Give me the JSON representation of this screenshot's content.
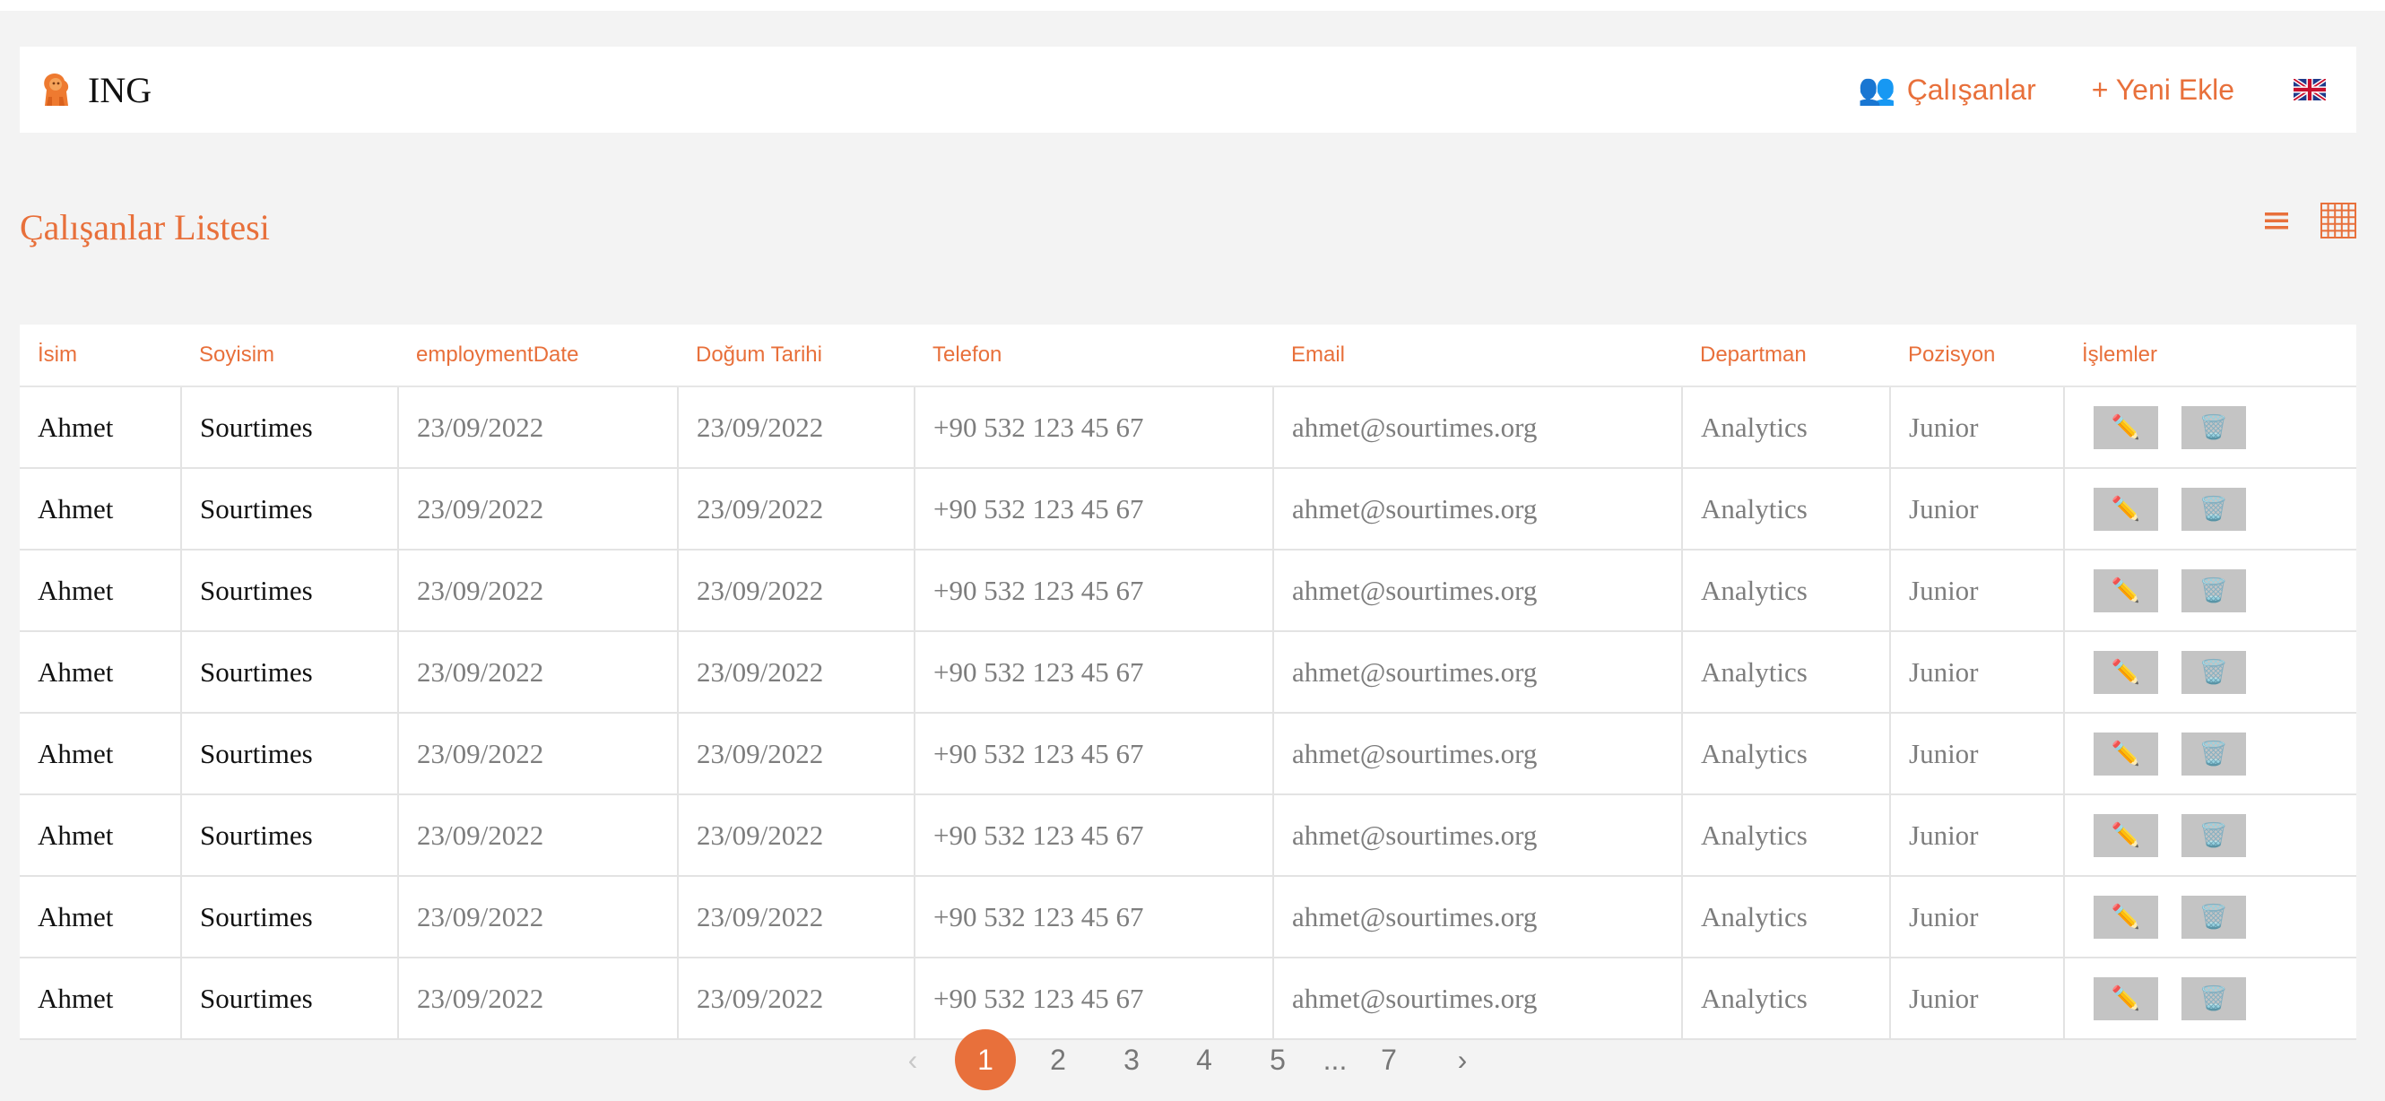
{
  "brand": {
    "name": "ING"
  },
  "nav": {
    "employees_label": "Çalışanlar",
    "add_new_label": "+ Yeni Ekle"
  },
  "page": {
    "title": "Çalışanlar Listesi"
  },
  "colors": {
    "accent": "#e8703b",
    "action_button": "#c4c4c4"
  },
  "table": {
    "headers": [
      "İsim",
      "Soyisim",
      "employmentDate",
      "Doğum Tarihi",
      "Telefon",
      "Email",
      "Departman",
      "Pozisyon",
      "İşlemler"
    ],
    "rows": [
      {
        "first": "Ahmet",
        "last": "Sourtimes",
        "employment": "23/09/2022",
        "birth": "23/09/2022",
        "phone": "+90 532 123 45 67",
        "email": "ahmet@sourtimes.org",
        "department": "Analytics",
        "position": "Junior"
      },
      {
        "first": "Ahmet",
        "last": "Sourtimes",
        "employment": "23/09/2022",
        "birth": "23/09/2022",
        "phone": "+90 532 123 45 67",
        "email": "ahmet@sourtimes.org",
        "department": "Analytics",
        "position": "Junior"
      },
      {
        "first": "Ahmet",
        "last": "Sourtimes",
        "employment": "23/09/2022",
        "birth": "23/09/2022",
        "phone": "+90 532 123 45 67",
        "email": "ahmet@sourtimes.org",
        "department": "Analytics",
        "position": "Junior"
      },
      {
        "first": "Ahmet",
        "last": "Sourtimes",
        "employment": "23/09/2022",
        "birth": "23/09/2022",
        "phone": "+90 532 123 45 67",
        "email": "ahmet@sourtimes.org",
        "department": "Analytics",
        "position": "Junior"
      },
      {
        "first": "Ahmet",
        "last": "Sourtimes",
        "employment": "23/09/2022",
        "birth": "23/09/2022",
        "phone": "+90 532 123 45 67",
        "email": "ahmet@sourtimes.org",
        "department": "Analytics",
        "position": "Junior"
      },
      {
        "first": "Ahmet",
        "last": "Sourtimes",
        "employment": "23/09/2022",
        "birth": "23/09/2022",
        "phone": "+90 532 123 45 67",
        "email": "ahmet@sourtimes.org",
        "department": "Analytics",
        "position": "Junior"
      },
      {
        "first": "Ahmet",
        "last": "Sourtimes",
        "employment": "23/09/2022",
        "birth": "23/09/2022",
        "phone": "+90 532 123 45 67",
        "email": "ahmet@sourtimes.org",
        "department": "Analytics",
        "position": "Junior"
      },
      {
        "first": "Ahmet",
        "last": "Sourtimes",
        "employment": "23/09/2022",
        "birth": "23/09/2022",
        "phone": "+90 532 123 45 67",
        "email": "ahmet@sourtimes.org",
        "department": "Analytics",
        "position": "Junior"
      }
    ]
  },
  "pagination": {
    "prev": "‹",
    "next": "›",
    "pages": [
      "1",
      "2",
      "3",
      "4",
      "5"
    ],
    "ellipsis": "...",
    "last": "7",
    "current": "1"
  }
}
